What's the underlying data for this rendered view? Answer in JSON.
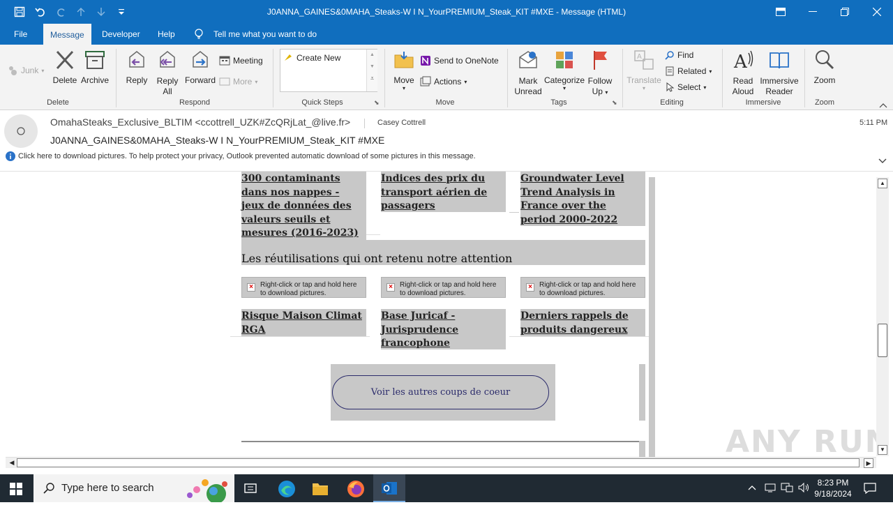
{
  "window": {
    "title": "J0ANNA_GAINES&0MAHA_Steaks-W I N_YourPREMIUM_Steak_KIT #MXE  -  Message (HTML)"
  },
  "tabs": [
    "File",
    "Message",
    "Developer",
    "Help"
  ],
  "active_tab": "Message",
  "tell_me": "Tell me what you want to do",
  "ribbon": {
    "delete_group": {
      "junk": "Junk",
      "delete": "Delete",
      "archive": "Archive",
      "label": "Delete"
    },
    "respond_group": {
      "reply": "Reply",
      "reply_all_1": "Reply",
      "reply_all_2": "All",
      "forward": "Forward",
      "meeting": "Meeting",
      "more": "More",
      "label": "Respond"
    },
    "quick_steps": {
      "create_new": "Create New",
      "label": "Quick Steps"
    },
    "move_group": {
      "move": "Move",
      "send_onenote": "Send to OneNote",
      "actions": "Actions",
      "label": "Move"
    },
    "tags_group": {
      "mark_1": "Mark",
      "mark_2": "Unread",
      "categorize": "Categorize",
      "follow_1": "Follow",
      "follow_2": "Up",
      "label": "Tags"
    },
    "editing_group": {
      "translate": "Translate",
      "find": "Find",
      "related": "Related",
      "select": "Select",
      "label": "Editing"
    },
    "immersive_group": {
      "read_1": "Read",
      "read_2": "Aloud",
      "imm_1": "Immersive",
      "imm_2": "Reader",
      "label": "Immersive"
    },
    "zoom_group": {
      "zoom": "Zoom",
      "label": "Zoom"
    }
  },
  "message": {
    "from": "OmahaSteaks_Exclusive_BLTIM <ccottrell_UZK#ZcQRjLat_@live.fr>",
    "to": "Casey Cottrell",
    "time": "5:11 PM",
    "subject": "J0ANNA_GAINES&0MAHA_Steaks-W I N_YourPREMIUM_Steak_KIT  #MXE",
    "info_bar": "Click here to download pictures. To help protect your privacy, Outlook prevented automatic download of some pictures in this message."
  },
  "body": {
    "top_links": [
      "300 contaminants dans nos nappes - jeux de données des valeurs seuils et mesures (2016-2023)",
      "Indices des prix du transport aérien de passagers",
      "Groundwater Level Trend Analysis in France over the period 2000-2022"
    ],
    "section_title": "Les réutilisations qui ont retenu notre attention",
    "picture_placeholder": "Right-click or tap and hold here to download pictures.",
    "reuse_links": [
      "Risque Maison Climat RGA",
      "Base Juricaf - Jurisprudence francophone",
      "Derniers rappels de produits dangereux"
    ],
    "cta": "Voir les autres coups de coeur"
  },
  "watermark": "ANY RUN",
  "taskbar": {
    "search_placeholder": "Type here to search",
    "time": "8:23 PM",
    "date": "9/18/2024"
  }
}
